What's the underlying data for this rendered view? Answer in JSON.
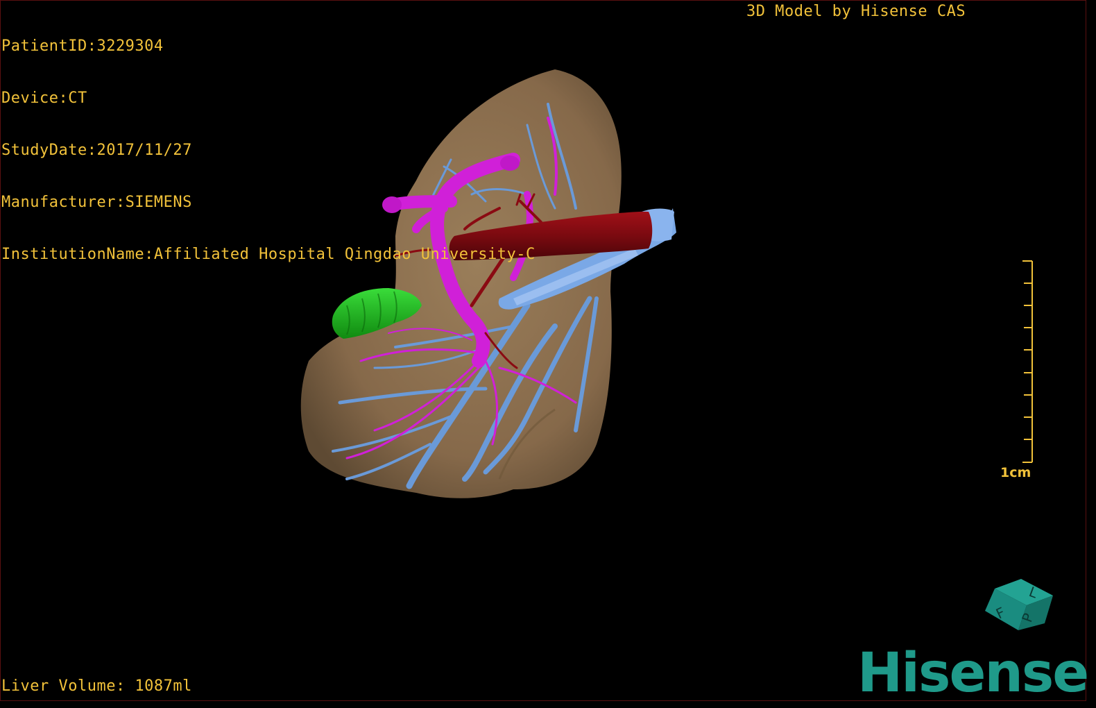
{
  "dicom_info": {
    "patient_id": "PatientID:3229304",
    "device": "Device:CT",
    "study_date": "StudyDate:2017/11/27",
    "manufacturer": "Manufacturer:SIEMENS",
    "institution": "InstitutionName:Affiliated Hospital Qingdao University-C"
  },
  "caption": "3D Model by Hisense CAS",
  "liver_volume": "Liver Volume: 1087ml",
  "scale_bar": {
    "label": "1cm"
  },
  "orientation_cube": {
    "labels": [
      "F",
      "L",
      "P"
    ],
    "color": "#1a8c80"
  },
  "logo": {
    "text": "Hisense",
    "color": "#1f9a8a"
  },
  "colors": {
    "text": "#f2c23a",
    "liver": "#8a7050",
    "portal_vein": "#d020d8",
    "hepatic_vein": "#6a9ad8",
    "artery": "#8a0a12",
    "gallbladder": "#1fb81f"
  }
}
